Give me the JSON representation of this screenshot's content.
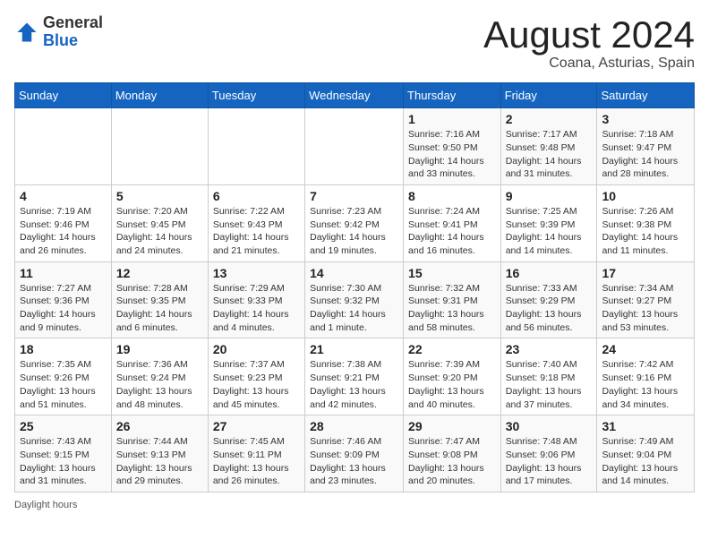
{
  "header": {
    "logo_line1": "General",
    "logo_line2": "Blue",
    "title": "August 2024",
    "subtitle": "Coana, Asturias, Spain"
  },
  "days_of_week": [
    "Sunday",
    "Monday",
    "Tuesday",
    "Wednesday",
    "Thursday",
    "Friday",
    "Saturday"
  ],
  "weeks": [
    [
      {
        "day": "",
        "info": ""
      },
      {
        "day": "",
        "info": ""
      },
      {
        "day": "",
        "info": ""
      },
      {
        "day": "",
        "info": ""
      },
      {
        "day": "1",
        "info": "Sunrise: 7:16 AM\nSunset: 9:50 PM\nDaylight: 14 hours and 33 minutes."
      },
      {
        "day": "2",
        "info": "Sunrise: 7:17 AM\nSunset: 9:48 PM\nDaylight: 14 hours and 31 minutes."
      },
      {
        "day": "3",
        "info": "Sunrise: 7:18 AM\nSunset: 9:47 PM\nDaylight: 14 hours and 28 minutes."
      }
    ],
    [
      {
        "day": "4",
        "info": "Sunrise: 7:19 AM\nSunset: 9:46 PM\nDaylight: 14 hours and 26 minutes."
      },
      {
        "day": "5",
        "info": "Sunrise: 7:20 AM\nSunset: 9:45 PM\nDaylight: 14 hours and 24 minutes."
      },
      {
        "day": "6",
        "info": "Sunrise: 7:22 AM\nSunset: 9:43 PM\nDaylight: 14 hours and 21 minutes."
      },
      {
        "day": "7",
        "info": "Sunrise: 7:23 AM\nSunset: 9:42 PM\nDaylight: 14 hours and 19 minutes."
      },
      {
        "day": "8",
        "info": "Sunrise: 7:24 AM\nSunset: 9:41 PM\nDaylight: 14 hours and 16 minutes."
      },
      {
        "day": "9",
        "info": "Sunrise: 7:25 AM\nSunset: 9:39 PM\nDaylight: 14 hours and 14 minutes."
      },
      {
        "day": "10",
        "info": "Sunrise: 7:26 AM\nSunset: 9:38 PM\nDaylight: 14 hours and 11 minutes."
      }
    ],
    [
      {
        "day": "11",
        "info": "Sunrise: 7:27 AM\nSunset: 9:36 PM\nDaylight: 14 hours and 9 minutes."
      },
      {
        "day": "12",
        "info": "Sunrise: 7:28 AM\nSunset: 9:35 PM\nDaylight: 14 hours and 6 minutes."
      },
      {
        "day": "13",
        "info": "Sunrise: 7:29 AM\nSunset: 9:33 PM\nDaylight: 14 hours and 4 minutes."
      },
      {
        "day": "14",
        "info": "Sunrise: 7:30 AM\nSunset: 9:32 PM\nDaylight: 14 hours and 1 minute."
      },
      {
        "day": "15",
        "info": "Sunrise: 7:32 AM\nSunset: 9:31 PM\nDaylight: 13 hours and 58 minutes."
      },
      {
        "day": "16",
        "info": "Sunrise: 7:33 AM\nSunset: 9:29 PM\nDaylight: 13 hours and 56 minutes."
      },
      {
        "day": "17",
        "info": "Sunrise: 7:34 AM\nSunset: 9:27 PM\nDaylight: 13 hours and 53 minutes."
      }
    ],
    [
      {
        "day": "18",
        "info": "Sunrise: 7:35 AM\nSunset: 9:26 PM\nDaylight: 13 hours and 51 minutes."
      },
      {
        "day": "19",
        "info": "Sunrise: 7:36 AM\nSunset: 9:24 PM\nDaylight: 13 hours and 48 minutes."
      },
      {
        "day": "20",
        "info": "Sunrise: 7:37 AM\nSunset: 9:23 PM\nDaylight: 13 hours and 45 minutes."
      },
      {
        "day": "21",
        "info": "Sunrise: 7:38 AM\nSunset: 9:21 PM\nDaylight: 13 hours and 42 minutes."
      },
      {
        "day": "22",
        "info": "Sunrise: 7:39 AM\nSunset: 9:20 PM\nDaylight: 13 hours and 40 minutes."
      },
      {
        "day": "23",
        "info": "Sunrise: 7:40 AM\nSunset: 9:18 PM\nDaylight: 13 hours and 37 minutes."
      },
      {
        "day": "24",
        "info": "Sunrise: 7:42 AM\nSunset: 9:16 PM\nDaylight: 13 hours and 34 minutes."
      }
    ],
    [
      {
        "day": "25",
        "info": "Sunrise: 7:43 AM\nSunset: 9:15 PM\nDaylight: 13 hours and 31 minutes."
      },
      {
        "day": "26",
        "info": "Sunrise: 7:44 AM\nSunset: 9:13 PM\nDaylight: 13 hours and 29 minutes."
      },
      {
        "day": "27",
        "info": "Sunrise: 7:45 AM\nSunset: 9:11 PM\nDaylight: 13 hours and 26 minutes."
      },
      {
        "day": "28",
        "info": "Sunrise: 7:46 AM\nSunset: 9:09 PM\nDaylight: 13 hours and 23 minutes."
      },
      {
        "day": "29",
        "info": "Sunrise: 7:47 AM\nSunset: 9:08 PM\nDaylight: 13 hours and 20 minutes."
      },
      {
        "day": "30",
        "info": "Sunrise: 7:48 AM\nSunset: 9:06 PM\nDaylight: 13 hours and 17 minutes."
      },
      {
        "day": "31",
        "info": "Sunrise: 7:49 AM\nSunset: 9:04 PM\nDaylight: 13 hours and 14 minutes."
      }
    ]
  ],
  "footer": {
    "label": "Daylight hours"
  }
}
